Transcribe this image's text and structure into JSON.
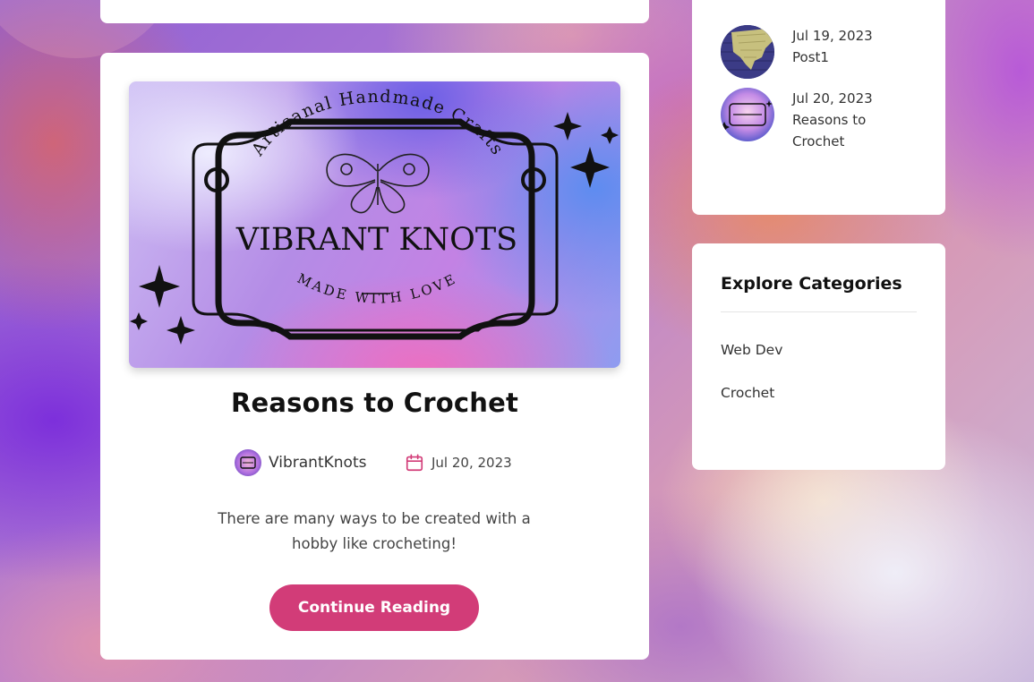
{
  "colors": {
    "accent": "#d23c78",
    "card_bg": "#ffffff",
    "heading_text": "#111111",
    "body_text": "#444444"
  },
  "post": {
    "image": {
      "icon": "vibrant-knots-logo",
      "logo_arc_text": "Artisanal Handmade Crafts",
      "logo_title": "VIBRANT KNOTS",
      "logo_bottom_text": "MADE WITH LOVE"
    },
    "title": "Reasons to Crochet",
    "author": {
      "name": "VibrantKnots",
      "avatar_icon": "author-avatar"
    },
    "date": {
      "icon": "calendar-icon",
      "text": "Jul 20, 2023"
    },
    "excerpt": "There are many ways to be created with a hobby like crocheting!",
    "cta_label": "Continue Reading"
  },
  "recent_posts": [
    {
      "date": "Jul 19, 2023",
      "title": "Post1",
      "thumb_icon": "crochet-thumbnail"
    },
    {
      "date": "Jul 20, 2023",
      "title": "Reasons to Crochet",
      "thumb_icon": "vibrant-knots-thumbnail"
    }
  ],
  "categories": {
    "heading": "Explore Categories",
    "items": [
      "Web Dev",
      "Crochet"
    ]
  }
}
